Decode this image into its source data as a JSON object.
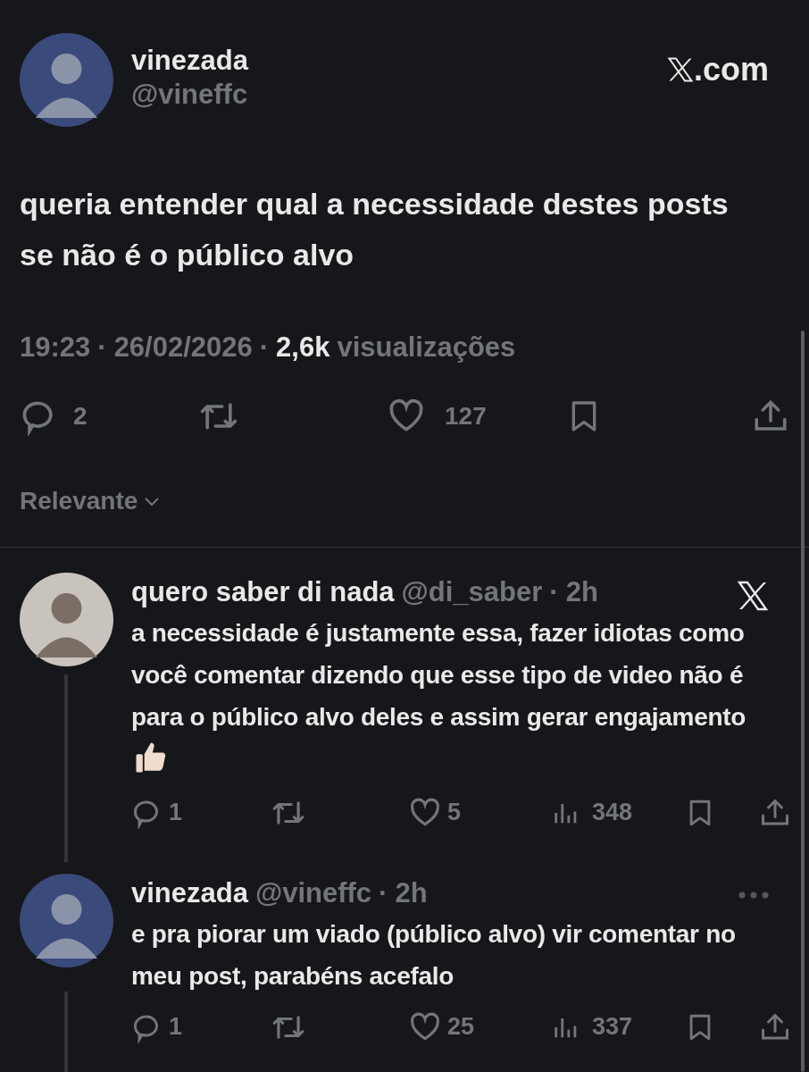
{
  "post": {
    "name": "vinezada",
    "handle": "@vineffc",
    "site": ".com",
    "text": "queria entender qual a necessidade destes posts se não é o público alvo",
    "time": "19:23",
    "sep_1": "·",
    "date": "26/02/2026",
    "sep_2": "·",
    "views_count": "2,6k",
    "views_label": "visualizações",
    "replies": "2",
    "likes": "127"
  },
  "sort": {
    "label": "Relevante"
  },
  "replies": [
    {
      "kind": "external",
      "name": "quero saber di nada",
      "handle": "@di_saber",
      "sep": "·",
      "age": "2h",
      "text": "a necessidade é justamente essa, fazer idiotas como você comentar dizendo que esse tipo de video não é para o público alvo deles e assim gerar engajamento",
      "emoji_end": true,
      "replies": "1",
      "likes": "5",
      "views": "348"
    },
    {
      "kind": "own",
      "name": "vinezada",
      "handle": "@vineffc",
      "sep": "·",
      "age": "2h",
      "text": "e pra piorar um viado (público alvo) vir comentar no meu post, parabéns acefalo",
      "emoji_end": false,
      "replies": "1",
      "likes": "25",
      "views": "337"
    }
  ]
}
